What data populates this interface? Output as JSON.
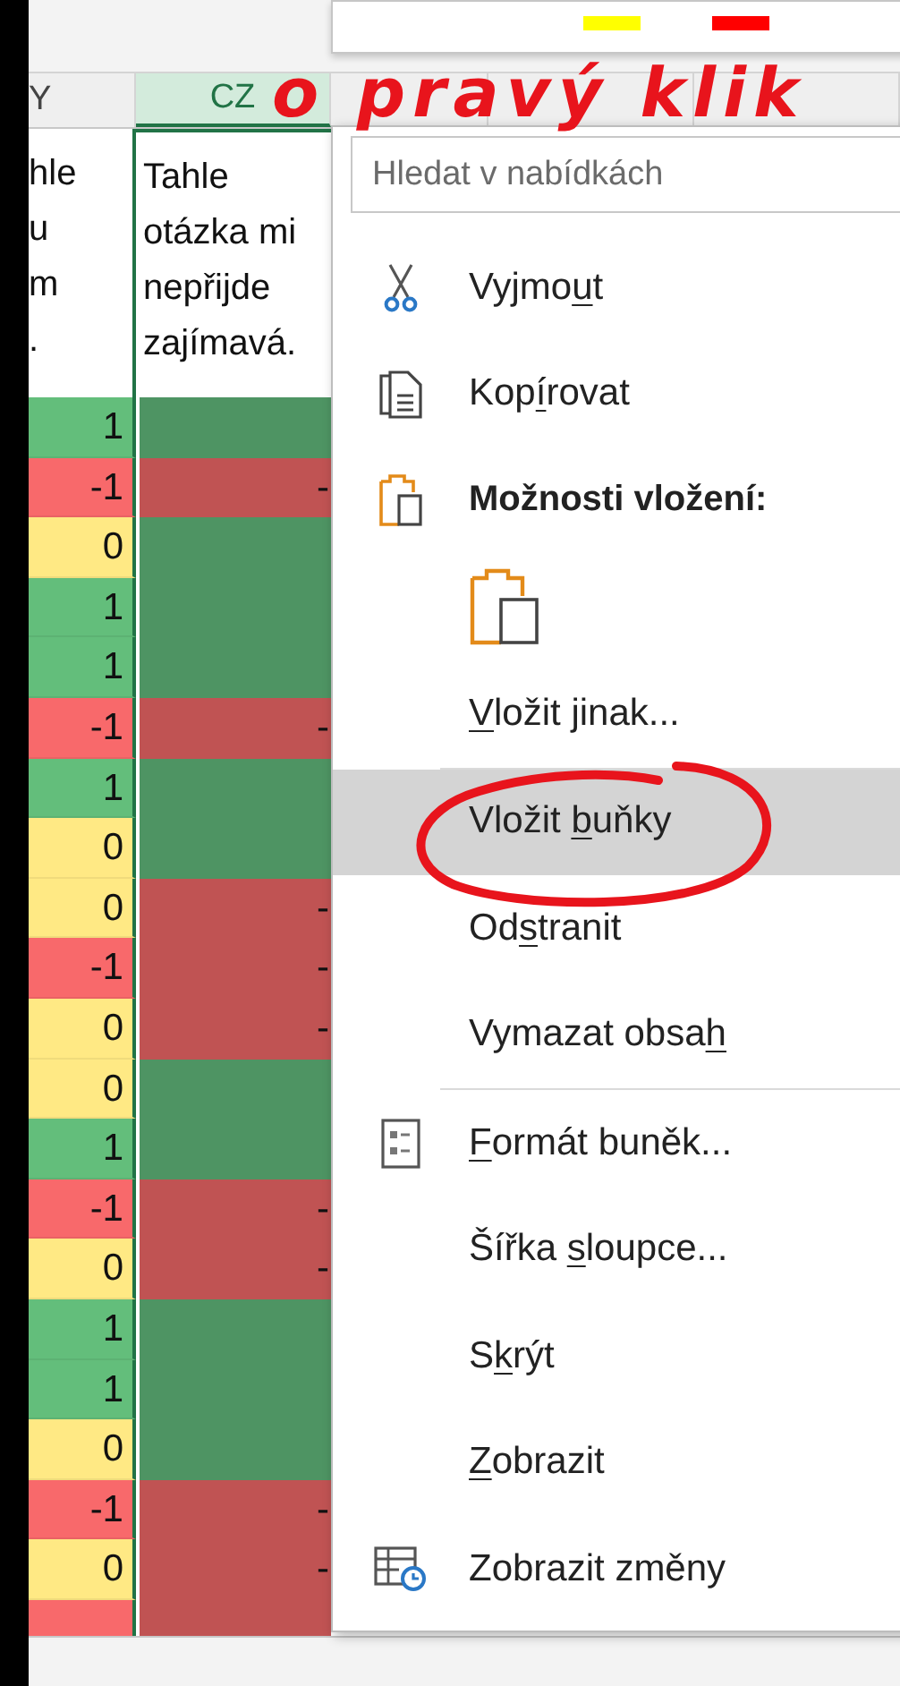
{
  "mini_toolbar": {
    "swatches": [
      {
        "color": "#ffff00"
      },
      {
        "color": "#ff0000"
      }
    ]
  },
  "sheet": {
    "columns": [
      {
        "label": "Y",
        "selected": false
      },
      {
        "label": "CZ",
        "selected": true
      }
    ],
    "header_cells": [
      {
        "lines": [
          "hle",
          "u",
          "m",
          "."
        ]
      },
      {
        "text": "Tahle otázka mi nepřijde zajímavá."
      }
    ],
    "rows": [
      {
        "cells": [
          {
            "value": "1",
            "color": "#63be7b"
          },
          {
            "color": "#4e9463"
          }
        ]
      },
      {
        "cells": [
          {
            "value": "-1",
            "color": "#f8696b"
          },
          {
            "value": "-",
            "color": "#c05353"
          }
        ]
      },
      {
        "cells": [
          {
            "value": "0",
            "color": "#ffe984"
          },
          {
            "color": "#4e9463"
          }
        ]
      },
      {
        "cells": [
          {
            "value": "1",
            "color": "#63be7b"
          },
          {
            "color": "#4e9463"
          }
        ]
      },
      {
        "cells": [
          {
            "value": "1",
            "color": "#63be7b"
          },
          {
            "color": "#4e9463"
          }
        ]
      },
      {
        "cells": [
          {
            "value": "-1",
            "color": "#f8696b"
          },
          {
            "value": "-",
            "color": "#c05353"
          }
        ]
      },
      {
        "cells": [
          {
            "value": "1",
            "color": "#63be7b"
          },
          {
            "color": "#4e9463"
          }
        ]
      },
      {
        "cells": [
          {
            "value": "0",
            "color": "#ffe984"
          },
          {
            "color": "#4e9463"
          }
        ]
      },
      {
        "cells": [
          {
            "value": "0",
            "color": "#ffe984"
          },
          {
            "value": "-",
            "color": "#c05353"
          }
        ]
      },
      {
        "cells": [
          {
            "value": "-1",
            "color": "#f8696b"
          },
          {
            "value": "-",
            "color": "#c05353"
          }
        ]
      },
      {
        "cells": [
          {
            "value": "0",
            "color": "#ffe984"
          },
          {
            "value": "-",
            "color": "#c05353"
          }
        ]
      },
      {
        "cells": [
          {
            "value": "0",
            "color": "#ffe984"
          },
          {
            "color": "#4e9463"
          }
        ]
      },
      {
        "cells": [
          {
            "value": "1",
            "color": "#63be7b"
          },
          {
            "color": "#4e9463"
          }
        ]
      },
      {
        "cells": [
          {
            "value": "-1",
            "color": "#f8696b"
          },
          {
            "value": "-",
            "color": "#c05353"
          }
        ]
      },
      {
        "cells": [
          {
            "value": "0",
            "color": "#ffe984"
          },
          {
            "value": "-",
            "color": "#c05353"
          }
        ]
      },
      {
        "cells": [
          {
            "value": "1",
            "color": "#63be7b"
          },
          {
            "color": "#4e9463"
          }
        ]
      },
      {
        "cells": [
          {
            "value": "1",
            "color": "#63be7b"
          },
          {
            "color": "#4e9463"
          }
        ]
      },
      {
        "cells": [
          {
            "value": "0",
            "color": "#ffe984"
          },
          {
            "color": "#4e9463"
          }
        ]
      },
      {
        "cells": [
          {
            "value": "-1",
            "color": "#f8696b"
          },
          {
            "value": "-",
            "color": "#c05353"
          }
        ]
      },
      {
        "cells": [
          {
            "value": "0",
            "color": "#ffe984"
          },
          {
            "value": "-",
            "color": "#c05353"
          }
        ]
      },
      {
        "cells": [
          {
            "color": "#f8696b"
          },
          {
            "color": "#c05353"
          }
        ]
      }
    ]
  },
  "context_menu": {
    "search": {
      "placeholder": "Hledat v nabídkách"
    },
    "items": [
      {
        "kind": "cut",
        "pre": "Vyjmo",
        "key": "u",
        "post": "t",
        "highlighted": false
      },
      {
        "kind": "copy",
        "pre": "Kop",
        "key": "í",
        "post": "rovat",
        "highlighted": false
      },
      {
        "kind": "heading",
        "label": "Možnosti vložení:"
      },
      {
        "kind": "paste-option"
      },
      {
        "kind": "command",
        "key": "V",
        "post": "ložit jinak...",
        "highlighted": false
      },
      {
        "kind": "separator"
      },
      {
        "kind": "command",
        "pre": "Vložit ",
        "key": "b",
        "post": "uňky",
        "highlighted": true
      },
      {
        "kind": "command",
        "pre": "Od",
        "key": "s",
        "post": "tranit",
        "highlighted": false
      },
      {
        "kind": "command",
        "pre": "Vymazat obsa",
        "key": "h",
        "highlighted": false
      },
      {
        "kind": "separator"
      },
      {
        "kind": "format",
        "key": "F",
        "post": "ormát buněk...",
        "highlighted": false
      },
      {
        "kind": "command",
        "pre": "Šířka ",
        "key": "s",
        "post": "loupce...",
        "highlighted": false
      },
      {
        "kind": "command",
        "pre": "S",
        "key": "k",
        "post": "rýt",
        "highlighted": false
      },
      {
        "kind": "command",
        "key": "Z",
        "post": "obrazit",
        "highlighted": false
      },
      {
        "kind": "changes",
        "pre": "Zobrazit změny",
        "highlighted": false
      }
    ]
  },
  "annotation": {
    "text": "o pravý klik"
  }
}
